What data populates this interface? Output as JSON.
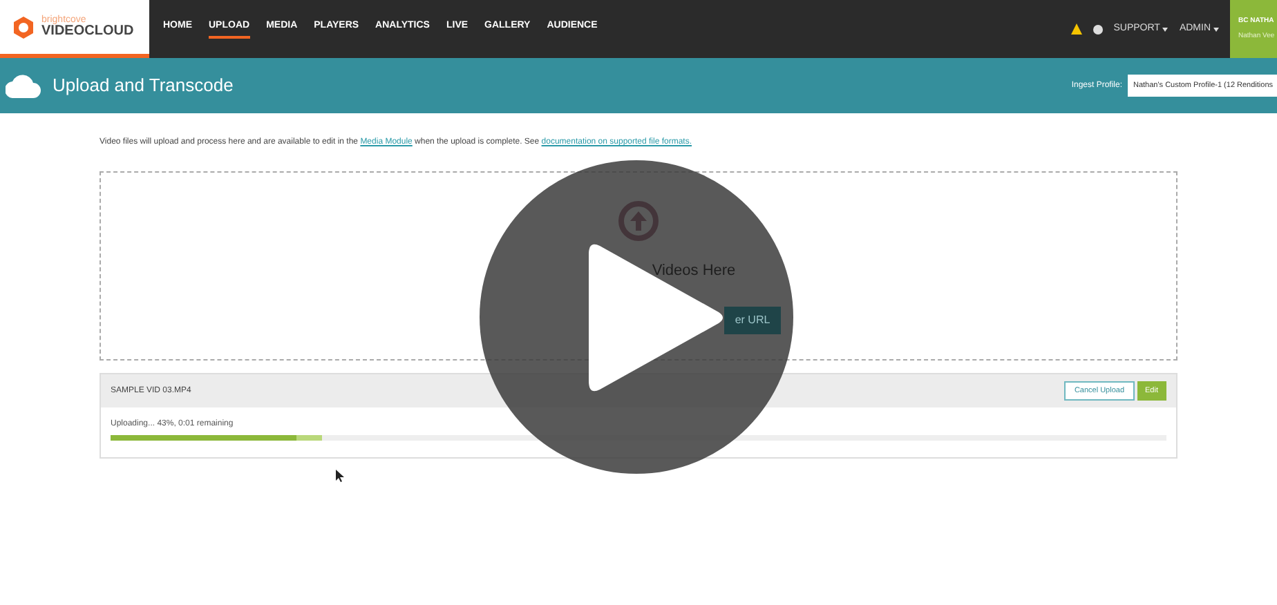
{
  "brand": {
    "small": "brightcove",
    "large": "VIDEOCLOUD"
  },
  "nav": [
    {
      "label": "HOME",
      "selected": false
    },
    {
      "label": "UPLOAD",
      "selected": true
    },
    {
      "label": "MEDIA",
      "selected": false
    },
    {
      "label": "PLAYERS",
      "selected": false
    },
    {
      "label": "ANALYTICS",
      "selected": false
    },
    {
      "label": "LIVE",
      "selected": false
    },
    {
      "label": "GALLERY",
      "selected": false
    },
    {
      "label": "AUDIENCE",
      "selected": false
    }
  ],
  "menus": [
    "SUPPORT",
    "ADMIN"
  ],
  "account": {
    "name": "BC NATHA",
    "user": "Nathan Vee"
  },
  "page_title": "Upload and Transcode",
  "ingest_profile": {
    "label": "Ingest Profile:",
    "value": "Nathan's Custom Profile-1 (12 Renditions"
  },
  "intro": {
    "before": "Video files will upload and process here and are available to edit in the",
    "link1": "Media Module",
    "middle": "when the upload is complete. See",
    "link2": "documentation on supported file formats."
  },
  "drop_zone": {
    "title": "Videos Here",
    "button": "er URL"
  },
  "upload": {
    "file": "SAMPLE VID 03.MP4",
    "status": "Uploading... 43%, 0:01 remaining",
    "level": 0.2,
    "buttons": [
      "Cancel Upload",
      "Edit"
    ]
  }
}
